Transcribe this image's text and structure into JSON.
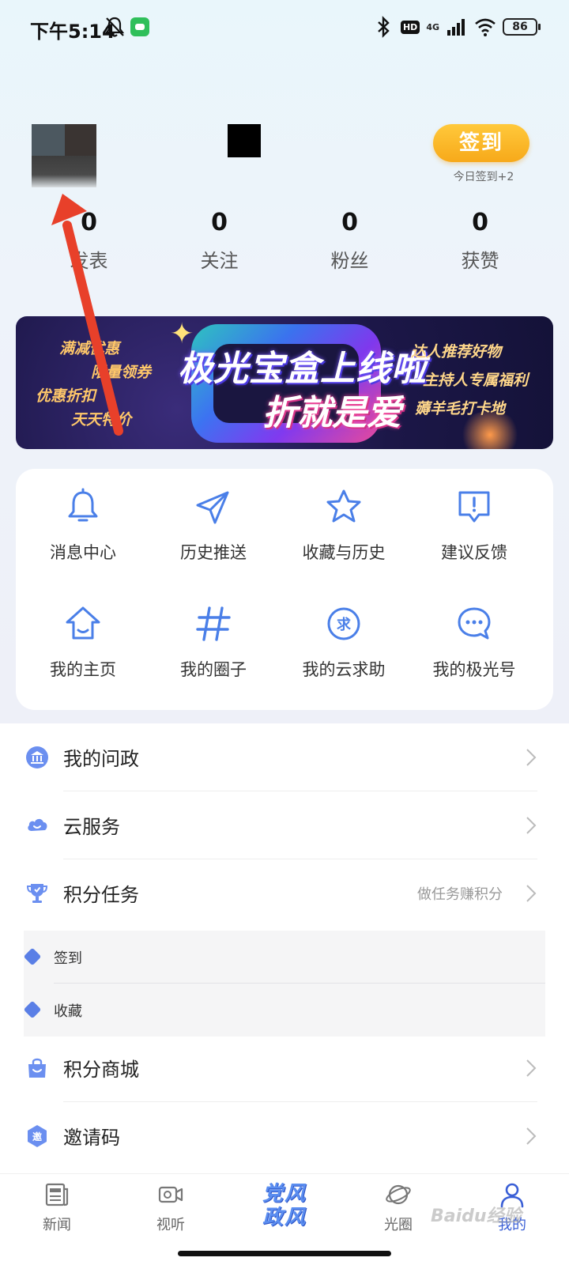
{
  "status_bar": {
    "time": "下午5:14",
    "network": "4G",
    "hd": "HD",
    "battery": "86"
  },
  "profile": {
    "signin_label": "签到",
    "signin_note": "今日签到+2",
    "stats": [
      {
        "value": "0",
        "label": "发表"
      },
      {
        "value": "0",
        "label": "关注"
      },
      {
        "value": "0",
        "label": "粉丝"
      },
      {
        "value": "0",
        "label": "获赞"
      }
    ]
  },
  "banner": {
    "title": "极光宝盒上线啦",
    "subtitle": "折就是爱",
    "left_lines": [
      "满减优惠",
      "限量领券",
      "优惠折扣",
      "天天特价"
    ],
    "right_lines": [
      "达人推荐好物",
      "主持人专属福利",
      "薅羊毛打卡地"
    ]
  },
  "grid": [
    {
      "label": "消息中心",
      "icon": "bell-icon"
    },
    {
      "label": "历史推送",
      "icon": "send-icon"
    },
    {
      "label": "收藏与历史",
      "icon": "star-icon"
    },
    {
      "label": "建议反馈",
      "icon": "feedback-icon"
    },
    {
      "label": "我的主页",
      "icon": "home-icon"
    },
    {
      "label": "我的圈子",
      "icon": "hashtag-icon"
    },
    {
      "label": "我的云求助",
      "icon": "help-icon"
    },
    {
      "label": "我的极光号",
      "icon": "chat-icon"
    }
  ],
  "list": [
    {
      "label": "我的问政",
      "hint": "",
      "icon": "government-icon"
    },
    {
      "label": "云服务",
      "hint": "",
      "icon": "cloud-icon"
    },
    {
      "label": "积分任务",
      "hint": "做任务赚积分",
      "icon": "trophy-icon"
    },
    {
      "label": "积分商城",
      "hint": "",
      "icon": "shopping-bag-icon"
    },
    {
      "label": "邀请码",
      "hint": "",
      "icon": "invite-icon"
    }
  ],
  "sub_items": [
    "签到",
    "收藏"
  ],
  "tabs": [
    {
      "label": "新闻",
      "icon": "news-icon"
    },
    {
      "label": "视听",
      "icon": "video-icon"
    },
    {
      "line1": "党风",
      "line2": "政风"
    },
    {
      "label": "光圈",
      "icon": "planet-icon"
    },
    {
      "label": "我的",
      "icon": "person-icon"
    }
  ],
  "colors": {
    "accent": "#3a5fd6",
    "icon_blue": "#4a7fe8",
    "signin": "#f7b02a",
    "arrow": "#e8402a"
  },
  "watermark": "Baidu经验"
}
